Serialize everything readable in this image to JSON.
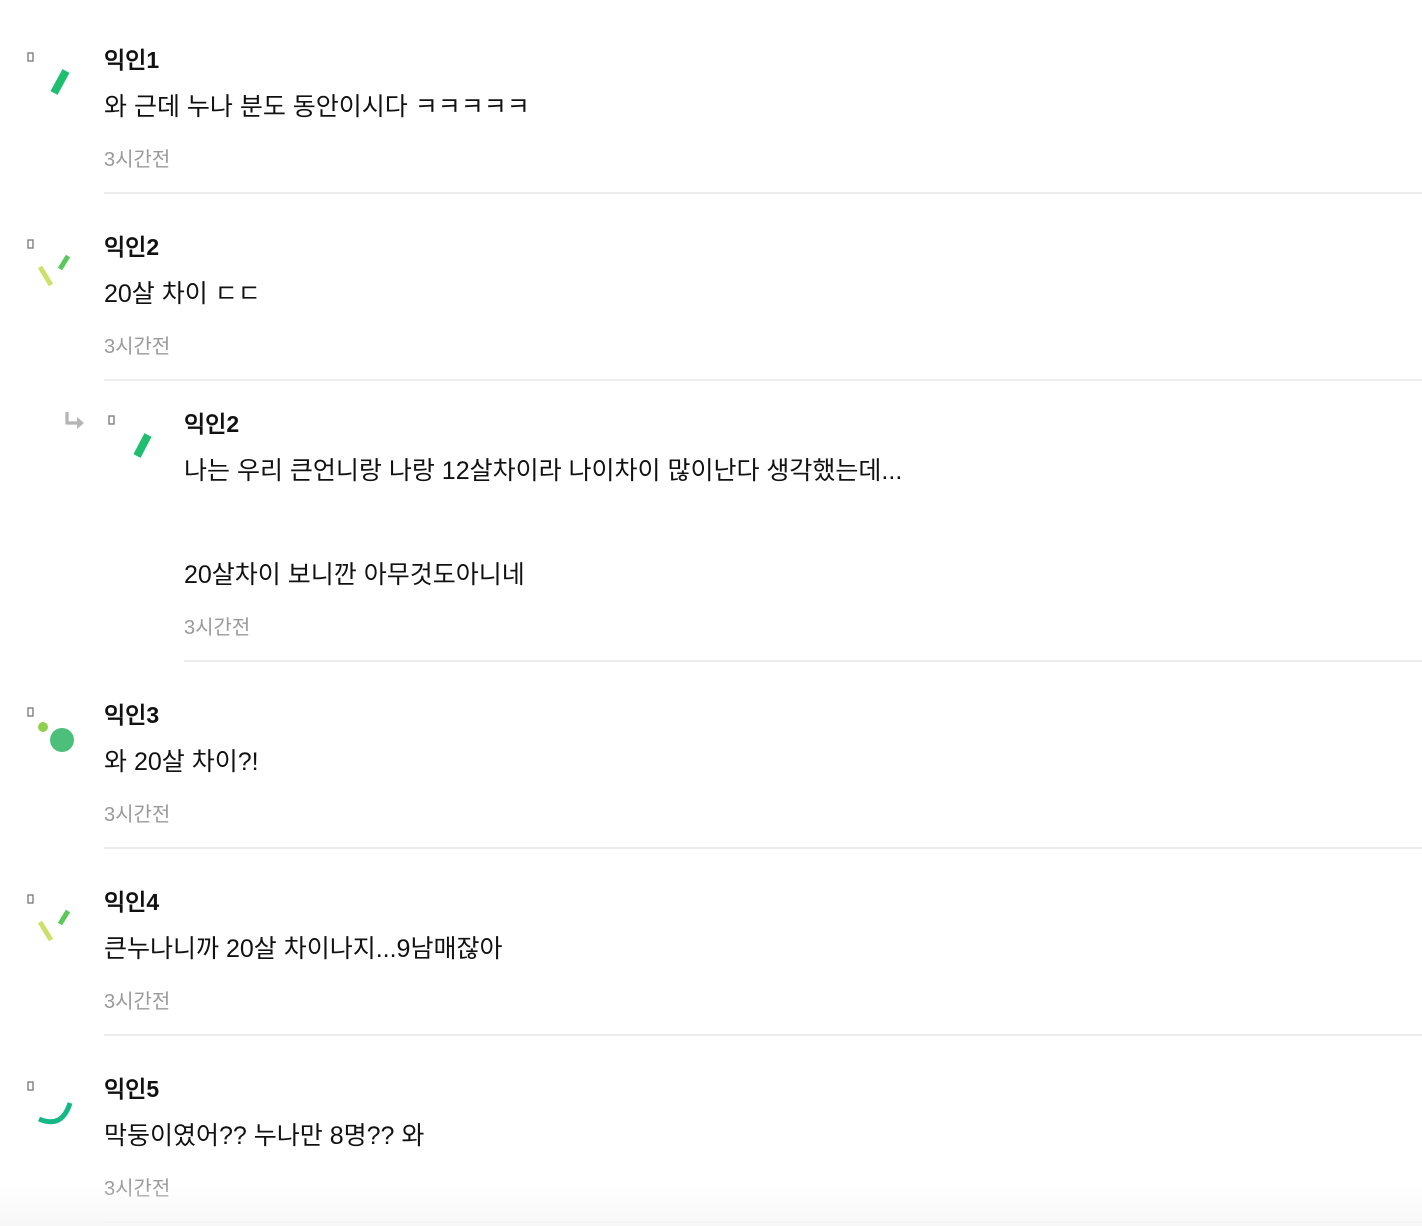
{
  "comments": [
    {
      "author": "익인1",
      "body": "와 근데 누나 분도 동안이시다 ㅋㅋㅋㅋㅋ",
      "time": "3시간전",
      "avatar_icon": "green-slash-icon",
      "is_reply": false
    },
    {
      "author": "익인2",
      "body": "20살 차이 ㄷㄷ",
      "time": "3시간전",
      "avatar_icon": "double-tick-icon",
      "is_reply": false
    },
    {
      "author": "익인2",
      "body_lines": [
        "나는 우리 큰언니랑 나랑 12살차이라 나이차이 많이난다 생각했는데...",
        "20살차이 보니깐 아무것도아니네"
      ],
      "time": "3시간전",
      "avatar_icon": "green-slash-icon",
      "is_reply": true,
      "reply_icon": "reply-arrow-icon"
    },
    {
      "author": "익인3",
      "body": "와 20살 차이?!",
      "time": "3시간전",
      "avatar_icon": "green-dots-icon",
      "is_reply": false
    },
    {
      "author": "익인4",
      "body": "큰누나니까 20살 차이나지...9남매잖아",
      "time": "3시간전",
      "avatar_icon": "double-tick-icon",
      "is_reply": false
    },
    {
      "author": "익인5",
      "body": "막둥이였어?? 누나만 8명?? 와",
      "time": "3시간전",
      "avatar_icon": "green-arc-icon",
      "is_reply": false
    }
  ],
  "colors": {
    "accent_green": "#1fbf6f",
    "light_green": "#cfe06a",
    "mid_green": "#5ac95a",
    "circle_green": "#4cc07a",
    "arc_teal": "#14b886",
    "timestamp_gray": "#9a9a9a",
    "divider_gray": "#ececec"
  }
}
